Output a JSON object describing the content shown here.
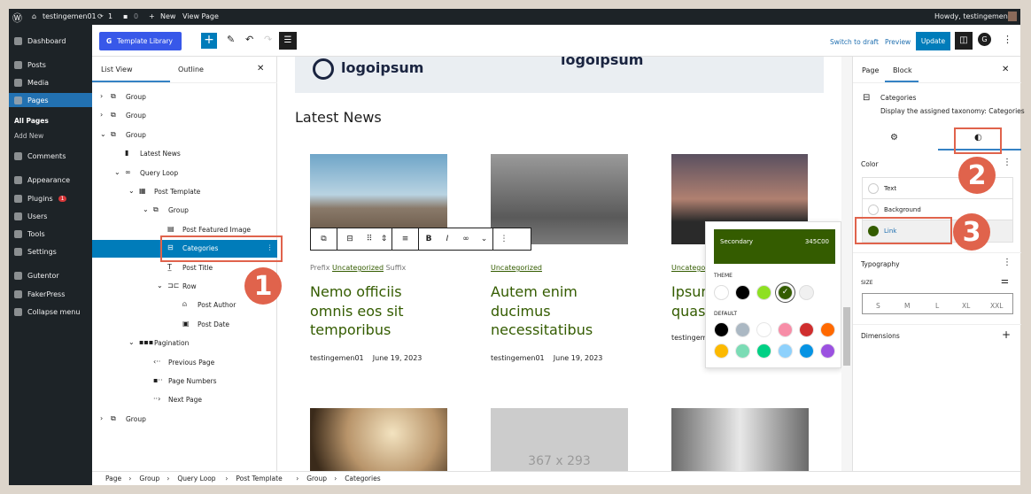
{
  "admin_bar": {
    "site": "testingemen01",
    "updates": "1",
    "comments": "0",
    "new": "New",
    "view_page": "View Page",
    "howdy": "Howdy, testingemen01"
  },
  "admin_menu": {
    "items": [
      "Dashboard",
      "Posts",
      "Media",
      "Pages",
      "Comments",
      "Appearance",
      "Plugins",
      "Users",
      "Tools",
      "Settings",
      "Gutentor",
      "FakerPress",
      "Collapse menu"
    ],
    "plugins_badge": "1",
    "pages_sub": [
      "All Pages",
      "Add New"
    ]
  },
  "toolbar": {
    "template_library": "Template Library",
    "switch_to_draft": "Switch to draft",
    "preview": "Preview",
    "update": "Update"
  },
  "list_view": {
    "tabs": [
      "List View",
      "Outline"
    ],
    "items": [
      {
        "label": "Group",
        "level": 0,
        "chev": "›",
        "icon": "group"
      },
      {
        "label": "Group",
        "level": 0,
        "chev": "›",
        "icon": "group"
      },
      {
        "label": "Group",
        "level": 0,
        "chev": "⌄",
        "icon": "group"
      },
      {
        "label": "Latest News",
        "level": 1,
        "chev": "",
        "icon": "bookmark"
      },
      {
        "label": "Query Loop",
        "level": 1,
        "chev": "⌄",
        "icon": "loop"
      },
      {
        "label": "Post Template",
        "level": 2,
        "chev": "⌄",
        "icon": "template"
      },
      {
        "label": "Group",
        "level": 3,
        "chev": "⌄",
        "icon": "group"
      },
      {
        "label": "Post Featured Image",
        "level": 4,
        "chev": "",
        "icon": "image"
      },
      {
        "label": "Categories",
        "level": 4,
        "chev": "",
        "icon": "categories",
        "selected": true
      },
      {
        "label": "Post Title",
        "level": 4,
        "chev": "",
        "icon": "title"
      },
      {
        "label": "Row",
        "level": 4,
        "chev": "⌄",
        "icon": "row"
      },
      {
        "label": "Post Author",
        "level": 5,
        "chev": "",
        "icon": "author"
      },
      {
        "label": "Post Date",
        "level": 5,
        "chev": "",
        "icon": "date"
      },
      {
        "label": "Pagination",
        "level": 2,
        "chev": "⌄",
        "icon": "pagination"
      },
      {
        "label": "Previous Page",
        "level": 3,
        "chev": "",
        "icon": "prev"
      },
      {
        "label": "Page Numbers",
        "level": 3,
        "chev": "",
        "icon": "numbers"
      },
      {
        "label": "Next Page",
        "level": 3,
        "chev": "",
        "icon": "next"
      },
      {
        "label": "Group",
        "level": 0,
        "chev": "›",
        "icon": "group"
      }
    ]
  },
  "canvas": {
    "logo_text": "logoipsum",
    "heading": "Latest News",
    "posts": [
      {
        "prefix": "Prefix",
        "category": "Uncategorized",
        "suffix": "Suffix",
        "title": "Nemo officiis omnis eos sit temporibus",
        "author": "testingemen01",
        "date": "June 19, 2023"
      },
      {
        "category": "Uncategorized",
        "title": "Autem enim ducimus necessitatibus",
        "author": "testingemen01",
        "date": "June 19, 2023"
      },
      {
        "category": "Uncategorized",
        "title": "Ipsum quas",
        "author": "testingemen01",
        "date": ""
      }
    ],
    "placeholder": "367 x 293"
  },
  "color_popover": {
    "selected_name": "Secondary",
    "selected_hex": "345C00",
    "theme_label": "THEME",
    "default_label": "DEFAULT",
    "theme": [
      "#ffffff",
      "#000000",
      "#8ee022",
      "#345c00",
      "#f0f0f0"
    ],
    "default": [
      "#000000",
      "#abb8c3",
      "#ffffff",
      "#f78da7",
      "#cf2e2e",
      "#ff6900",
      "#fcb900",
      "#7bdcb5",
      "#00d084",
      "#8ed1fc",
      "#0693e3",
      "#9b51e0"
    ]
  },
  "sidebar": {
    "tabs": [
      "Page",
      "Block"
    ],
    "block_name": "Categories",
    "block_desc": "Display the assigned taxonomy: Categories",
    "color_heading": "Color",
    "color_items": [
      "Text",
      "Background",
      "Link"
    ],
    "link_color": "#345c00",
    "typography": "Typography",
    "size_label": "SIZE",
    "sizes": [
      "S",
      "M",
      "L",
      "XL",
      "XXL"
    ],
    "dimensions": "Dimensions"
  },
  "breadcrumb": [
    "Page",
    "Group",
    "Query Loop",
    "Post Template",
    "Group",
    "Categories"
  ],
  "annotations": [
    "1",
    "2",
    "3"
  ],
  "colors": {
    "accent": "#007cba",
    "annotation": "#e0634c",
    "link": "#345c00"
  }
}
